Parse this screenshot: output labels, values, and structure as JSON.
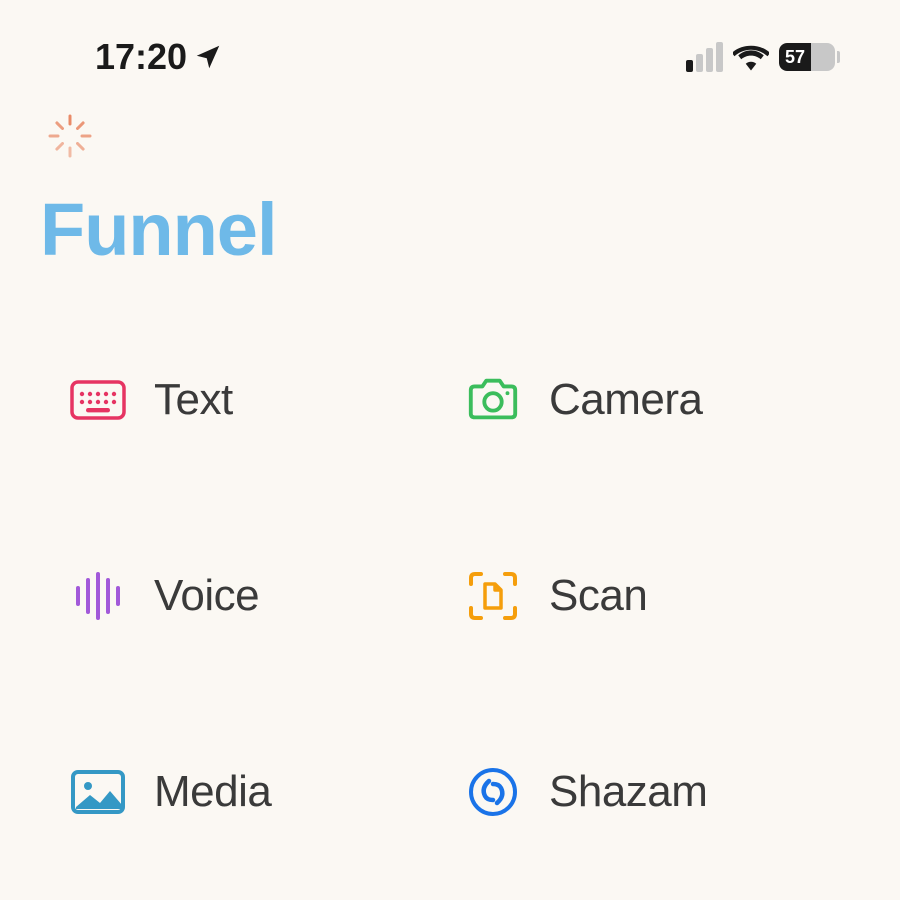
{
  "status": {
    "time": "17:20",
    "battery_percent": "57",
    "signal_active": 1
  },
  "app": {
    "title": "Funnel"
  },
  "grid": {
    "items": [
      {
        "label": "Text",
        "icon": "keyboard-icon",
        "color": "#e63462"
      },
      {
        "label": "Camera",
        "icon": "camera-icon",
        "color": "#3bbd5c"
      },
      {
        "label": "Voice",
        "icon": "voice-wave-icon",
        "color": "#a259d9"
      },
      {
        "label": "Scan",
        "icon": "scan-document-icon",
        "color": "#f59e0b"
      },
      {
        "label": "Media",
        "icon": "media-image-icon",
        "color": "#3498c5"
      },
      {
        "label": "Shazam",
        "icon": "shazam-icon",
        "color": "#1a73e8"
      }
    ]
  }
}
